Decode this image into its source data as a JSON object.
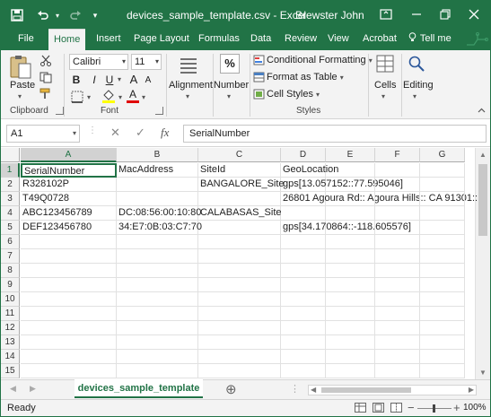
{
  "titlebar": {
    "title": "devices_sample_template.csv - Excel",
    "user": "Brewster John"
  },
  "tabs": [
    "File",
    "Home",
    "Insert",
    "Page Layout",
    "Formulas",
    "Data",
    "Review",
    "View",
    "Acrobat",
    "Tell me"
  ],
  "ribbon": {
    "clipboard": {
      "paste": "Paste",
      "label": "Clipboard"
    },
    "font": {
      "name": "Calibri",
      "size": "11",
      "bold": "B",
      "italic": "I",
      "underline": "U",
      "grow": "A",
      "shrink": "A",
      "label": "Font"
    },
    "alignment": {
      "label": "Alignment"
    },
    "number": {
      "label": "Number",
      "icon_text": "%"
    },
    "styles": {
      "conditional": "Conditional Formatting",
      "format_table": "Format as Table",
      "cell_styles": "Cell Styles",
      "label": "Styles"
    },
    "cells": {
      "label": "Cells"
    },
    "editing": {
      "label": "Editing"
    }
  },
  "formula_bar": {
    "name_box": "A1",
    "cancel": "✕",
    "enter": "✓",
    "fx": "fx",
    "content": "SerialNumber"
  },
  "grid": {
    "columns": [
      "A",
      "B",
      "C",
      "D",
      "E",
      "F",
      "G"
    ],
    "rows": [
      "1",
      "2",
      "3",
      "4",
      "5",
      "6",
      "7",
      "8",
      "9",
      "10",
      "11",
      "12",
      "13",
      "14",
      "15"
    ],
    "cells": {
      "A1": "SerialNumber",
      "B1": "MacAddress",
      "C1": "SiteId",
      "D1": "GeoLocation",
      "A2": "R328102P",
      "C2": "BANGALORE_Site",
      "D2": "gps[13.057152::77.595046]",
      "A3": "T49Q0728",
      "D3": "26801 Agoura Rd:: Agoura Hills:: CA 91301::",
      "A4": "ABC123456789",
      "B4": "DC:08:56:00:10:80",
      "C4": "CALABASAS_Site",
      "A5": "DEF123456780",
      "B5": "34:E7:0B:03:C7:70",
      "D5": "gps[34.170864::-118.605576]"
    },
    "selected_cell": "A1"
  },
  "sheets": {
    "active": "devices_sample_template",
    "add": "⊕"
  },
  "status": {
    "ready": "Ready",
    "zoom": "100%",
    "minus": "−",
    "plus": "+"
  },
  "colors": {
    "accent": "#217346"
  }
}
